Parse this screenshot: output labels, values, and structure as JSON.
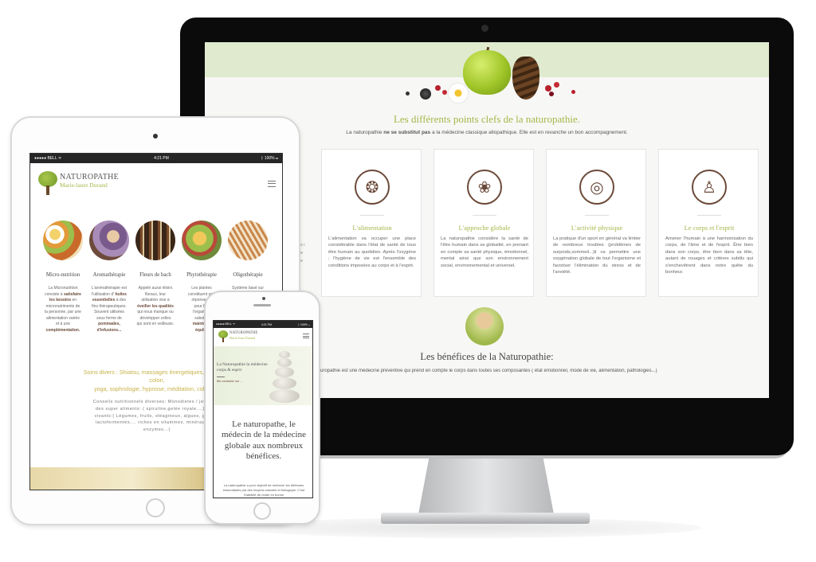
{
  "desktop": {
    "title": "Les différents points clefs de la naturopathie.",
    "subtitle_pre": "La naturopathie ",
    "subtitle_bold": "ne se substitut pas",
    "subtitle_post": " a la médecine classique allopathique. Elle est en revanche un bon accompagnement.",
    "edge_text": "s i e e",
    "cards": [
      {
        "title": "L'alimentation",
        "icon": "meditation-bowl-icon",
        "text": "L'alimentation va occuper une place considérable dans l'état de santé de tous être humain au quotidien. Après l'oxygène ; l'hygiène de vie est l'ensemble des conditions imposées au corps et à l'esprit."
      },
      {
        "title": "L'approche globale",
        "icon": "lotus-icon",
        "text": "La naturopathie considère la santé de l'être humain dans sa globalité, en prenant en compte sa santé physique, émotionnel, mental ainsi que son environnement social, environnemental et universel."
      },
      {
        "title": "L'activité physique",
        "icon": "yoga-mat-icon",
        "text": "La pratique d'un sport en général va limiter de nombreux troubles (problèmes de surpoids,sommeil...)il va permettre une oxygénation globale de tout l'organisme et favoriser l'élimination du stress et de l'anxiété."
      },
      {
        "title": "Le corps et l'esprit",
        "icon": "meditating-person-icon",
        "text": "Amener l'humain à une harmonisation du corps, de l'âme et de l'esprit. Être bien dans son corps, être bien dans sa tête, autant de rouages et critères subtils qui s'enchevêtrent dans notre quête du bonheur."
      }
    ],
    "benefits_title": "Les bénéfices de la Naturopathie:",
    "benefits_text": "aturopathie est une médecine préventive qui prend en compte le corps dans toutes ses composantes ( état émotionnel, mode de vie, alimentation, pathologies...)"
  },
  "tablet": {
    "status_left": "●●●●● BELL ᯤ",
    "status_time": "4:21 PM",
    "status_right": "ᛒ 100% ▭",
    "logo_name": "NATUROPATHE",
    "logo_sub": "Marie-laure Durand",
    "columns": [
      {
        "title": "Micro-nutrition",
        "lines": [
          "La Micronutrition",
          "consiste à satisfaire",
          "les besoins en",
          "micronutriments de",
          "la personne, par une",
          "alimentation variée",
          "et à une",
          "complémentation."
        ]
      },
      {
        "title": "Aromathérapie",
        "lines": [
          "L'aromathérapie est",
          "l'utilisation d' huiles",
          "essentielles à des",
          "fins thérapeutiques.",
          "Souvent utilisées",
          "sous forme de",
          "pommades,",
          "d'infusions..."
        ]
      },
      {
        "title": "Fleurs de bach",
        "lines": [
          "Appelé aussi élixirs",
          "floraux, leur",
          "utilisation vise à",
          "éveiller les qualités",
          "qui nous manque ou",
          "développer celles",
          "qui sont en veilleuse."
        ]
      },
      {
        "title": "Phytothérapie",
        "lines": [
          "Les plantes",
          "constituent une",
          "réponse de",
          "pour fort",
          "l'organism",
          "substan",
          "maintenir",
          "équilib"
        ]
      },
      {
        "title": "Oligothérapie",
        "lines": [
          "Système basé sur"
        ]
      }
    ],
    "soins_line1": "Soins divers : Shiatsu, massages énergetiques, réflexolog",
    "soins_line2": "colon,",
    "soins_line3": "yoga, sophrologie, hypnose, méditation, cohésion",
    "conseils_lines": [
      "Conseils nutritionnels diverses: Monodietes / jeûne/cur",
      "des super aliments: ( spiruline,gelée royale....) Bienf",
      "vivants:( Légumes, fruits, oléagineux, algues, graines",
      "lactofermentés.... riches en vitamines, minéraux, Ant",
      "enzymes...)"
    ]
  },
  "phone": {
    "status_left": "●●●●● BELL ᯤ",
    "status_time": "4:21 PM",
    "status_right": "ᛒ 100% ▭",
    "logo_name": "NATUROPATHE",
    "logo_sub": "Marie-laure Durand",
    "hero_title": "La Naturopathie la médecine corps & esprit",
    "contact": "Me contacter sur ...",
    "big_title": "Le naturopathe, le médecin de la médecine globale aux nombreux bénéfices.",
    "body_text": "La naturopathie a pour objectif de renforcer les défenses immunitaires par des moyens naturels et biologique. C'est l'habileté de rester en bonne"
  }
}
